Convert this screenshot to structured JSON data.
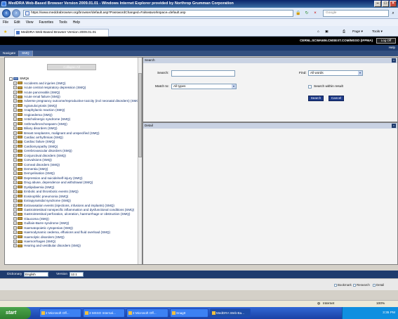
{
  "window": {
    "title": "MedDRA Web-Based Browser Version 2009.01.01 - Windows Internet Explorer provided by Northrop Grumman Corporation"
  },
  "addressbar": {
    "url": "https://www.meddrabrowser.org/browser/default.asp?PasswordChanged=False&workspace=default.asp",
    "search_placeholder": "Google"
  },
  "menu": [
    "File",
    "Edit",
    "View",
    "Favorites",
    "Tools",
    "Help"
  ],
  "tabbar": {
    "tab_title": "MedDRA Web-Based Browser Version 2009.01.01",
    "page_label": "Page",
    "tools_label": "Tools"
  },
  "app": {
    "user_label": "CERNL.SCWA506.CMSEXT.COM/MSSO (IFPMA)",
    "logoff_label": "Log Off",
    "help_label": "Help",
    "tabs": [
      "Navigate",
      "SMQ"
    ],
    "collapse_label": "Collapse All",
    "tree_root": "SMQs",
    "smq_items": [
      "Accidents and injuries (SMQ)",
      "Acute central respiratory depression (SMQ)",
      "Acute pancreatitis (SMQ)",
      "Acute renal failure (SMQ)",
      "Adverse pregnancy outcome/reproductive toxicity (incl neonatal disorders) (SMQ)",
      "Agranulocytosis (SMQ)",
      "Anaphylactic reaction (SMQ)",
      "Angioedema (SMQ)",
      "Anticholinergic syndrome (SMQ)",
      "Asthma/bronchospasm (SMQ)",
      "Biliary disorders (SMQ)",
      "Breast neoplasms, malignant and unspecified (SMQ)",
      "Cardiac arrhythmias (SMQ)",
      "Cardiac failure (SMQ)",
      "Cardiomyopathy (SMQ)",
      "Cerebrovascular disorders (SMQ)",
      "Conjunctival disorders (SMQ)",
      "Convulsions (SMQ)",
      "Corneal disorders (SMQ)",
      "Dementia (SMQ)",
      "Demyelination (SMQ)",
      "Depression and suicide/self-injury (SMQ)",
      "Drug abuse, dependence and withdrawal (SMQ)",
      "Dyslipidaemia (SMQ)",
      "Embolic and thrombotic events (SMQ)",
      "Eosinophilic pneumonia (SMQ)",
      "Extrapyramidal syndrome (SMQ)",
      "Extravasation events (injections, infusions and implants) (SMQ)",
      "Gastrointestinal nonspecific inflammation and dysfunctional conditions (SMQ)",
      "Gastrointestinal perforation, ulceration, haemorrhage or obstruction (SMQ)",
      "Glaucoma (SMQ)",
      "Guillain-Barre syndrome (SMQ)",
      "Haematopoietic cytopenias (SMQ)",
      "Haemodynamic oedema, effusions and fluid overload (SMQ)",
      "Haemolytic disorders (SMQ)",
      "Haemorrhages (SMQ)",
      "Hearing and vestibular disorders (SMQ)"
    ],
    "search": {
      "header": "Search",
      "search_label": "Search:",
      "search_value": "",
      "find_label": "Find:",
      "find_value": "All words",
      "match_label": "Match to:",
      "match_value": "All types",
      "within_label": "Search within result",
      "search_btn": "Search",
      "cancel_btn": "Cancel"
    },
    "detail": {
      "header": "Detail"
    },
    "bottom": {
      "dictionary_label": "Dictionary",
      "dictionary_value": "English",
      "version_label": "Version",
      "version_value": "12.1",
      "options": [
        "Bookmark",
        "Research",
        "Detail"
      ]
    }
  },
  "iestatus": {
    "zone": "Internet",
    "zoom": "100%"
  },
  "taskbar": {
    "start": "start",
    "buttons": [
      "2 Microsoft Off...",
      "3 MSSO Internal...",
      "2 Microsoft Off...",
      "SnagIt",
      "MedDRA Web-Ba..."
    ],
    "clock": "3:35 PM"
  }
}
